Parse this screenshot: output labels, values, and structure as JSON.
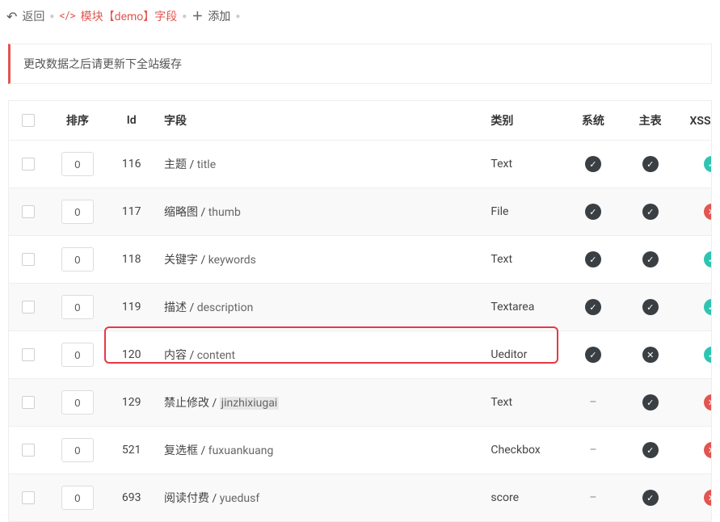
{
  "top": {
    "back": "返回",
    "breadcrumb": "模块【demo】字段",
    "add": "添加"
  },
  "notice": "更改数据之后请更新下全站缓存",
  "headers": {
    "sort": "排序",
    "id": "Id",
    "field": "字段",
    "type": "类别",
    "system": "系统",
    "main": "主表",
    "xss": "XSS过滤"
  },
  "rows": [
    {
      "sort": "0",
      "id": "116",
      "field_label": "主题",
      "field_code": "title",
      "type": "Text",
      "system": "y",
      "main": "y",
      "xss": "ok"
    },
    {
      "sort": "0",
      "id": "117",
      "field_label": "缩略图",
      "field_code": "thumb",
      "type": "File",
      "system": "y",
      "main": "y",
      "xss": "no"
    },
    {
      "sort": "0",
      "id": "118",
      "field_label": "关键字",
      "field_code": "keywords",
      "type": "Text",
      "system": "y",
      "main": "y",
      "xss": "ok"
    },
    {
      "sort": "0",
      "id": "119",
      "field_label": "描述",
      "field_code": "description",
      "type": "Textarea",
      "system": "y",
      "main": "y",
      "xss": "ok"
    },
    {
      "sort": "0",
      "id": "120",
      "field_label": "内容",
      "field_code": "content",
      "type": "Ueditor",
      "system": "y",
      "main": "x",
      "xss": "ok"
    },
    {
      "sort": "0",
      "id": "129",
      "field_label": "禁止修改",
      "field_code": "jinzhixiugai",
      "type": "Text",
      "system": "-",
      "main": "y",
      "xss": "no"
    },
    {
      "sort": "0",
      "id": "521",
      "field_label": "复选框",
      "field_code": "fuxuankuang",
      "type": "Checkbox",
      "system": "-",
      "main": "y",
      "xss": "no"
    },
    {
      "sort": "0",
      "id": "693",
      "field_label": "阅读付费",
      "field_code": "yuedusf",
      "type": "score",
      "system": "-",
      "main": "y",
      "xss": "no"
    }
  ]
}
